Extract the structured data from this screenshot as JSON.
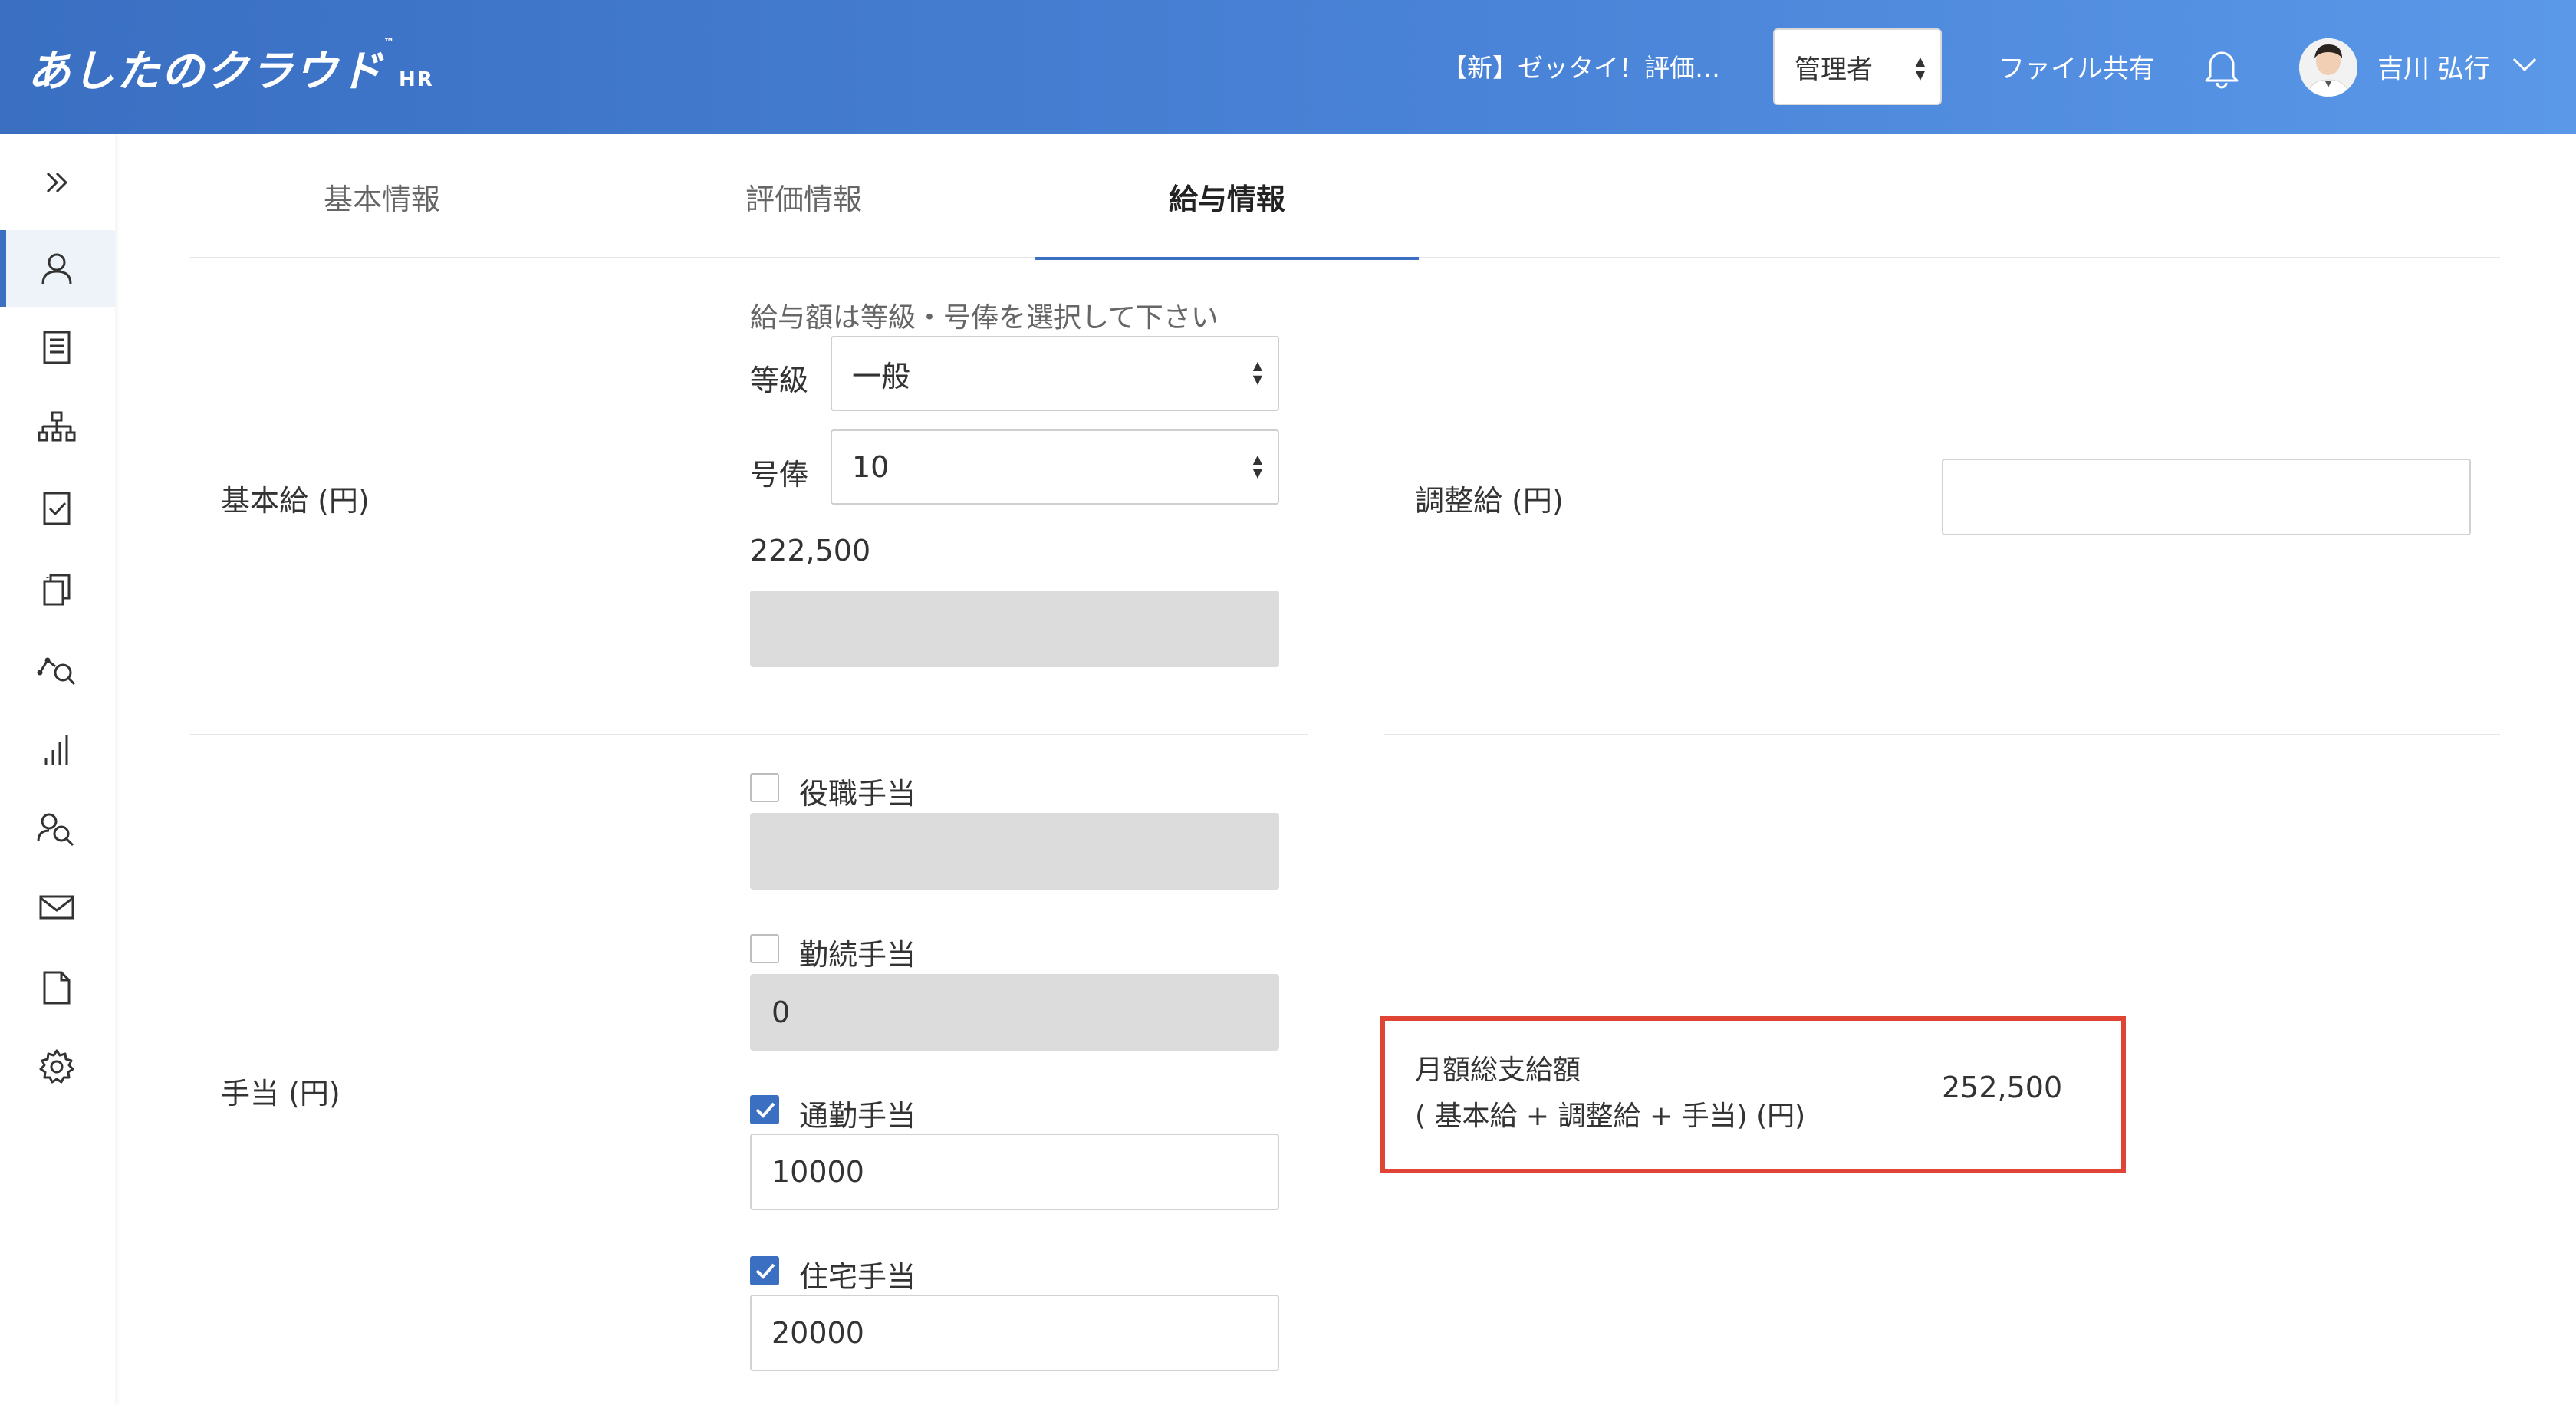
{
  "header": {
    "logo_text": "あしたのクラウド",
    "logo_tm": "™",
    "logo_sub": "HR",
    "eval_title": "【新】ゼッタイ！評価…",
    "role_select": "管理者",
    "file_share": "ファイル共有",
    "user_name": "吉川 弘行"
  },
  "tabs": [
    {
      "label": "基本情報"
    },
    {
      "label": "評価情報"
    },
    {
      "label": "給与情報"
    }
  ],
  "base_salary": {
    "label": "基本給 (円)",
    "hint": "給与額は等級・号俸を選択して下さい",
    "grade_label": "等級",
    "grade_value": "一般",
    "step_label": "号俸",
    "step_value": "10",
    "amount": "222,500",
    "override_value": ""
  },
  "adjustment": {
    "label": "調整給 (円)",
    "value": ""
  },
  "allowances": {
    "label": "手当 (円)",
    "items": [
      {
        "label": "役職手当",
        "checked": false,
        "value": ""
      },
      {
        "label": "勤続手当",
        "checked": false,
        "value": "0"
      },
      {
        "label": "通勤手当",
        "checked": true,
        "value": "10000"
      },
      {
        "label": "住宅手当",
        "checked": true,
        "value": "20000"
      }
    ]
  },
  "total": {
    "label_line1": "月額総支給額",
    "label_line2": "( 基本給 + 調整給 + 手当) (円)",
    "value": "252,500"
  },
  "colors": {
    "header_start": "#3a6fc2",
    "header_end": "#5b98e8",
    "accent": "#3a6fc2",
    "highlight_border": "#e04434"
  }
}
